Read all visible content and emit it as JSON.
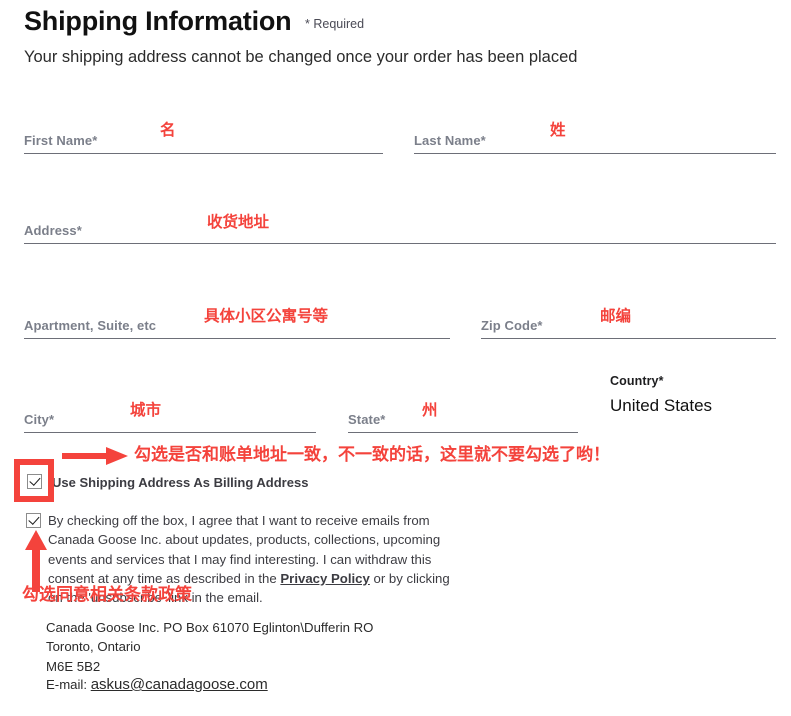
{
  "header": {
    "title": "Shipping Information",
    "required_note": "* Required",
    "subtitle": "Your shipping address cannot be changed once your order has been placed"
  },
  "form": {
    "fields": [
      {
        "label": "First Name*",
        "value": "",
        "annotation": "名"
      },
      {
        "label": "Last Name*",
        "value": "",
        "annotation": "姓"
      },
      {
        "label": "Address*",
        "value": "",
        "annotation": "收货地址"
      },
      {
        "label": "Apartment, Suite, etc",
        "value": "",
        "annotation": "具体小区公寓号等"
      },
      {
        "label": "Zip Code*",
        "value": "",
        "annotation": "邮编"
      },
      {
        "label": "City*",
        "value": "",
        "annotation": "城市"
      },
      {
        "label": "State*",
        "value": "",
        "annotation": "州"
      }
    ],
    "country": {
      "label": "Country*",
      "value": "United States"
    }
  },
  "billing": {
    "label": "Use Shipping Address As Billing Address",
    "checked": true,
    "annotation": "勾选是否和账单地址一致，不一致的话，这里就不要勾选了哟！"
  },
  "consent": {
    "checked": true,
    "text_before_link": "By checking off the box, I agree that I want to receive emails from Canada Goose Inc. about updates, products, collections, upcoming events and services that I may find interesting. I can withdraw this consent at any time as described in the ",
    "link_text": "Privacy Policy",
    "text_after_link": " or by clicking on the 'unsubscribe' link in the email.",
    "annotation": "勾选同意相关条款政策"
  },
  "footer": {
    "address_lines": "Canada Goose Inc. PO Box 61070 Eglinton\\Dufferin RO\nToronto, Ontario\nM6E 5B2",
    "email_label": "E-mail: ",
    "email": "askus@canadagoose.com"
  },
  "colors": {
    "annotation_red": "#f4433c",
    "label_gray": "#7b7f8a",
    "underline_gray": "#6d6f78",
    "text_dark": "#2b2b2b"
  },
  "icons": {
    "checkmark": "check-icon",
    "arrow_right": "arrow-right-icon",
    "arrow_up": "arrow-up-icon"
  }
}
